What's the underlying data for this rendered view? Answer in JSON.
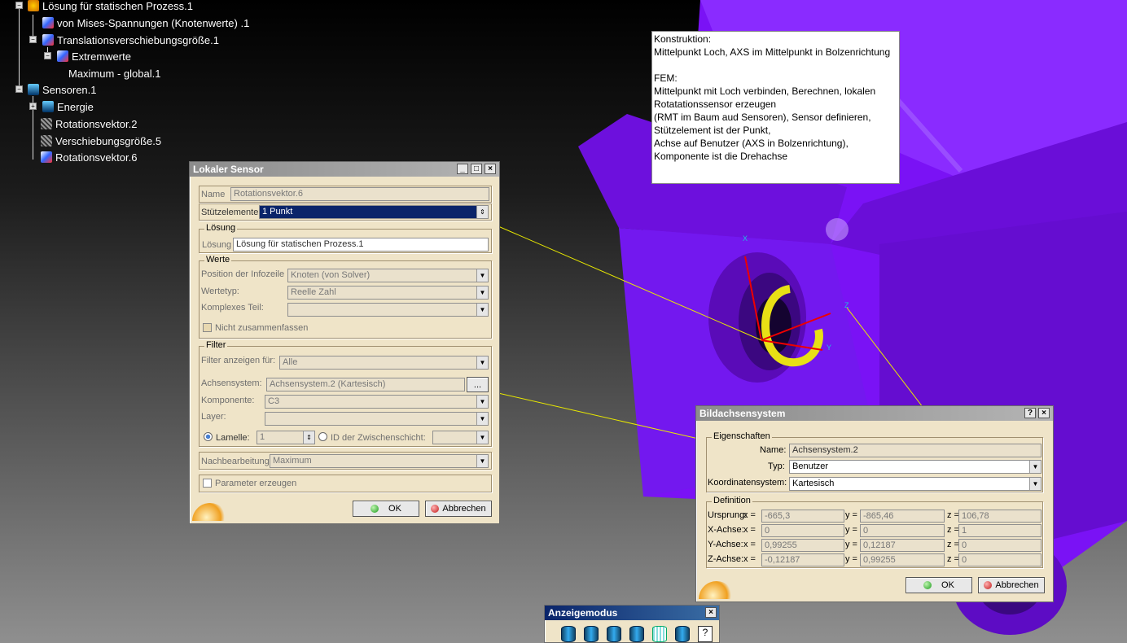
{
  "tree": [
    {
      "label": "Lösung für statischen Prozess.1"
    },
    {
      "label": "von Mises-Spannungen (Knotenwerte) .1"
    },
    {
      "label": "Translationsverschiebungsgröße.1"
    },
    {
      "label": "Extremwerte"
    },
    {
      "label": "Maximum - global.1"
    },
    {
      "label": "Sensoren.1"
    },
    {
      "label": "Energie"
    },
    {
      "label": "Rotationsvektor.2"
    },
    {
      "label": "Verschiebungsgröße.5"
    },
    {
      "label": "Rotationsvektor.6"
    }
  ],
  "note": {
    "text": "Konstruktion:\nMittelpunkt Loch, AXS im Mittelpunkt in Bolzenrichtung\n\nFEM:\nMittelpunkt mit Loch verbinden, Berechnen, lokalen Rotatationssensor erzeugen\n(RMT im Baum aud Sensoren), Sensor definieren, Stützelement ist der Punkt,\nAchse auf Benutzer (AXS in Bolzenrichtung), Komponente ist die Drehachse"
  },
  "sensor": {
    "title": "Lokaler Sensor",
    "name_label": "Name",
    "name_value": "Rotationsvektor.6",
    "support_label": "Stützelemente",
    "support_value": "1 Punkt",
    "solution_group": "Lösung",
    "solution_label": "Lösung",
    "solution_value": "Lösung für statischen Prozess.1",
    "values_group": "Werte",
    "position_label": "Position der Infozeile",
    "position_value": "Knoten (von Solver)",
    "valuetype_label": "Wertetyp:",
    "valuetype_value": "Reelle Zahl",
    "complex_label": "Komplexes Teil:",
    "complex_value": "",
    "nocombine_label": "Nicht zusammenfassen",
    "filter_group": "Filter",
    "filter_label": "Filter anzeigen für:",
    "filter_value": "Alle",
    "axis_label": "Achsensystem:",
    "axis_value": "Achsensystem.2 (Kartesisch)",
    "axis_btn": "...",
    "component_label": "Komponente:",
    "component_value": "C3",
    "layer_label": "Layer:",
    "layer_value": "",
    "lamella_label": "Lamelle:",
    "lamella_value": "1",
    "layerid_label": "ID der Zwischenschicht:",
    "layerid_value": "",
    "post_label": "Nachbearbeitung",
    "post_value": "Maximum",
    "param_label": "Parameter erzeugen",
    "ok": "OK",
    "cancel": "Abbrechen"
  },
  "axis": {
    "title": "Bildachsensystem",
    "props_group": "Eigenschaften",
    "name_label": "Name:",
    "name_value": "Achsensystem.2",
    "type_label": "Typ:",
    "type_value": "Benutzer",
    "coord_label": "Koordinatensystem:",
    "coord_value": "Kartesisch",
    "def_group": "Definition",
    "rows": [
      {
        "label": "Ursprung:",
        "x": "-665,3",
        "y": "-865,46",
        "z": "106,78"
      },
      {
        "label": "X-Achse:",
        "x": "0",
        "y": "0",
        "z": "1"
      },
      {
        "label": "Y-Achse:",
        "x": "0,99255",
        "y": "0,12187",
        "z": "0"
      },
      {
        "label": "Z-Achse:",
        "x": "-0,12187",
        "y": "0,99255",
        "z": "0"
      }
    ],
    "xl": "x =",
    "yl": "y =",
    "zl": "z =",
    "ok": "OK",
    "cancel": "Abbrechen"
  },
  "toolbar": {
    "title": "Anzeigemodus"
  }
}
